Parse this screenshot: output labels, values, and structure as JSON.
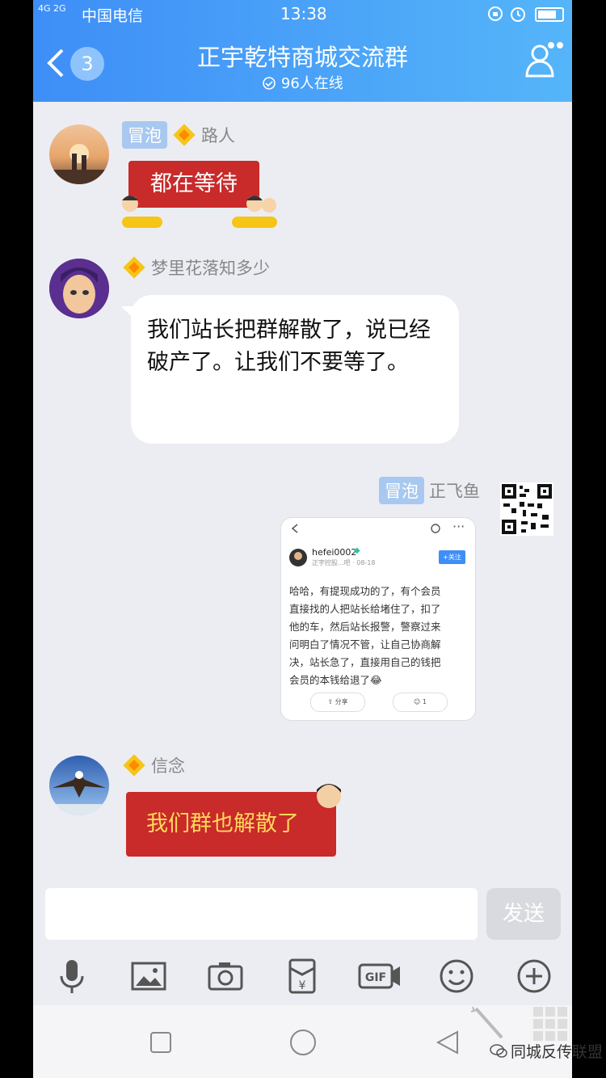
{
  "status": {
    "signal": "4G 2G",
    "carrier": "中国电信",
    "time": "13:38"
  },
  "header": {
    "back_count": "3",
    "title": "正宇乾特商城交流群",
    "online": "96人在线"
  },
  "messages": [
    {
      "sender": "路人",
      "tag": "冒泡",
      "text": "都在等待"
    },
    {
      "sender": "梦里花落知多少",
      "text": "我们站长把群解散了，说已经破产了。让我们不要等了。"
    },
    {
      "sender": "正飞鱼",
      "tag": "冒泡",
      "card": {
        "user": "hefei0002",
        "meta": "正宇控股...吧 · 08-18",
        "follow": "+关注",
        "lines": [
          "哈哈，有提现成功的了，有个会员",
          "直接找的人把站长给堵住了，扣了",
          "他的车，然后站长报警，警察过来",
          "问明白了情况不管，让自己协商解",
          "决，站长急了，直接用自己的钱把",
          "会员的本钱给退了😂"
        ],
        "share": "分享",
        "likes": "1"
      }
    },
    {
      "sender": "信念",
      "text": "我们群也解散了"
    }
  ],
  "input": {
    "send": "发送"
  },
  "watermark": "同城反传联盟",
  "colors": {
    "header_start": "#3e8ef7",
    "header_end": "#55b5f9",
    "red_bubble": "#c92a2a"
  }
}
